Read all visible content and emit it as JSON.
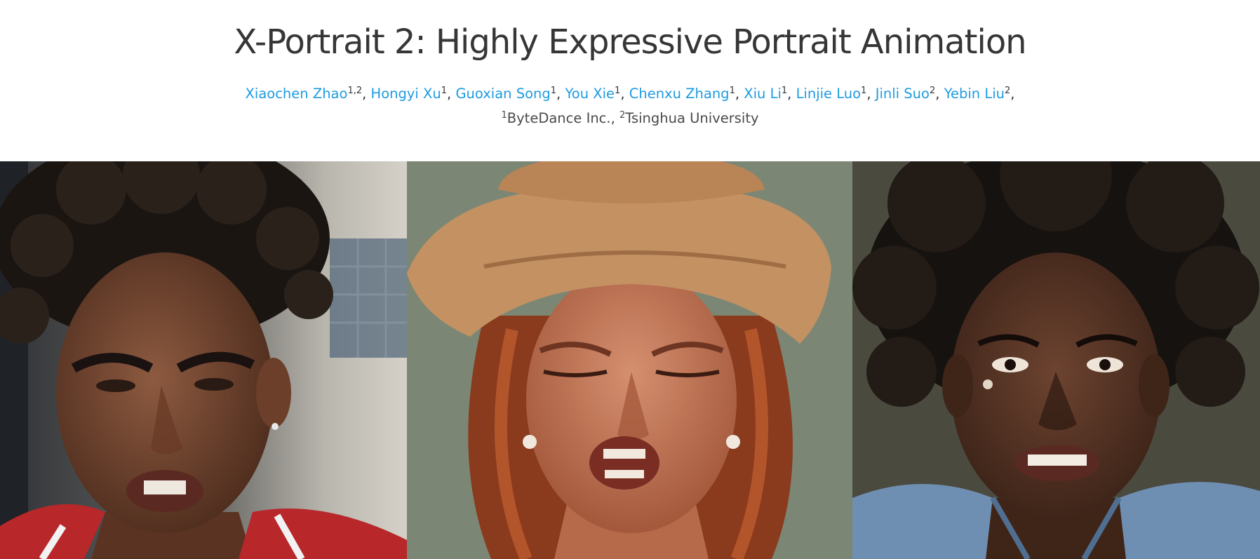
{
  "page": {
    "title": "X-Portrait 2: Highly Expressive Portrait Animation"
  },
  "authors": [
    {
      "name": "Xiaochen Zhao",
      "sup": "1,2"
    },
    {
      "name": "Hongyi Xu",
      "sup": "1"
    },
    {
      "name": "Guoxian Song",
      "sup": "1"
    },
    {
      "name": "You Xie",
      "sup": "1"
    },
    {
      "name": "Chenxu Zhang",
      "sup": "1"
    },
    {
      "name": "Xiu Li",
      "sup": "1"
    },
    {
      "name": "Linjie Luo",
      "sup": "1"
    },
    {
      "name": "Jinli Suo",
      "sup": "2"
    },
    {
      "name": "Yebin Liu",
      "sup": "2"
    }
  ],
  "affiliations": [
    {
      "sup": "1",
      "name": "ByteDance Inc.,"
    },
    {
      "sup": "2",
      "name": "Tsinghua University"
    }
  ],
  "colors": {
    "link": "#1e9be2",
    "text": "#363636"
  },
  "videos": [
    {
      "icon": "portrait-frowning-young-man"
    },
    {
      "icon": "portrait-woman-in-hat-grimacing"
    },
    {
      "icon": "portrait-woman-crying"
    }
  ]
}
